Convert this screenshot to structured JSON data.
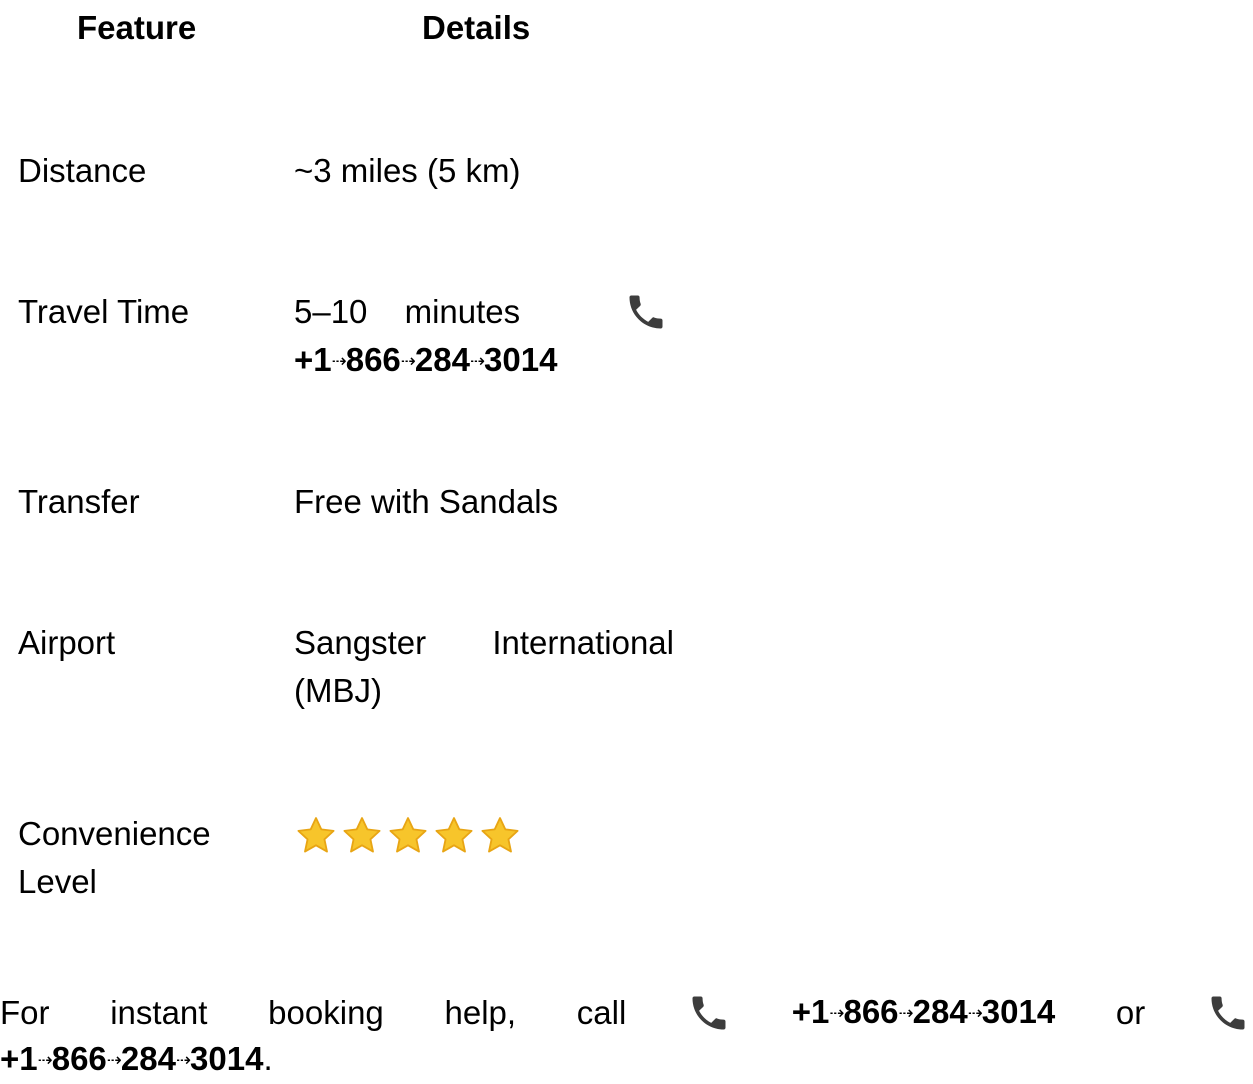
{
  "table": {
    "header": {
      "feature": "Feature",
      "details": "Details"
    },
    "rows": [
      {
        "feature": "Distance",
        "details": "~3 miles (5 km)"
      },
      {
        "feature": "Travel Time",
        "details_text": "5–10 minutes",
        "icon": "phone-icon",
        "phone": {
          "p1": "+1",
          "p2": "866",
          "p3": "284",
          "p4": "3014"
        }
      },
      {
        "feature": "Transfer",
        "details": "Free with Sandals"
      },
      {
        "feature": "Airport",
        "details": "Sangster International (MBJ)"
      },
      {
        "feature": "Convenience Level",
        "rating": 5,
        "rating_max": 5,
        "icon": "star-icon"
      }
    ]
  },
  "footer": {
    "w1": "For",
    "w2": "instant",
    "w3": "booking",
    "w4": "help,",
    "w5": "call",
    "or": "or",
    "period": ".",
    "phone": {
      "p1": "+1",
      "p2": "866",
      "p3": "284",
      "p4": "3014"
    }
  },
  "arrow_glyph": "⇢",
  "colors": {
    "text": "#000000",
    "phone_icon": "#3d3d3d",
    "star_fill": "#f7c52b",
    "star_outline": "#e8a514"
  }
}
